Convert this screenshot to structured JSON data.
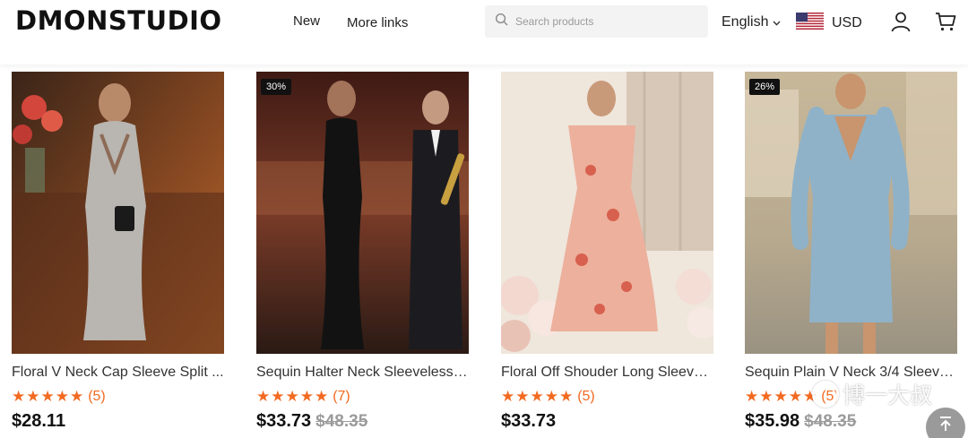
{
  "header": {
    "logo": "DMONSTUDIO",
    "nav": [
      {
        "label": "New"
      },
      {
        "label": "More links"
      }
    ],
    "search": {
      "placeholder": "Search products",
      "value": ""
    },
    "language": "English",
    "currency": "USD"
  },
  "products": [
    {
      "title": "Floral V Neck Cap Sleeve Split ...",
      "discount": "",
      "rating_count": "(5)",
      "price": "$28.11",
      "old_price": "",
      "stars": 5
    },
    {
      "title": "Sequin Halter Neck Sleeveless S...",
      "discount": "30%",
      "rating_count": "(7)",
      "price": "$33.73",
      "old_price": "$48.35",
      "stars": 5
    },
    {
      "title": "Floral Off Shouder Long Sleeve ...",
      "discount": "",
      "rating_count": "(5)",
      "price": "$33.73",
      "old_price": "",
      "stars": 5
    },
    {
      "title": "Sequin Plain V Neck 3/4 Sleeve...",
      "discount": "26%",
      "rating_count": "(5)",
      "price": "$35.98",
      "old_price": "$48.35",
      "stars": 5
    }
  ],
  "stars_text": "★★★★★",
  "watermark": "博一大叔",
  "colors": {
    "accent": "#f26a21",
    "badge": "#111111",
    "search_bg": "#f3f3f3"
  }
}
